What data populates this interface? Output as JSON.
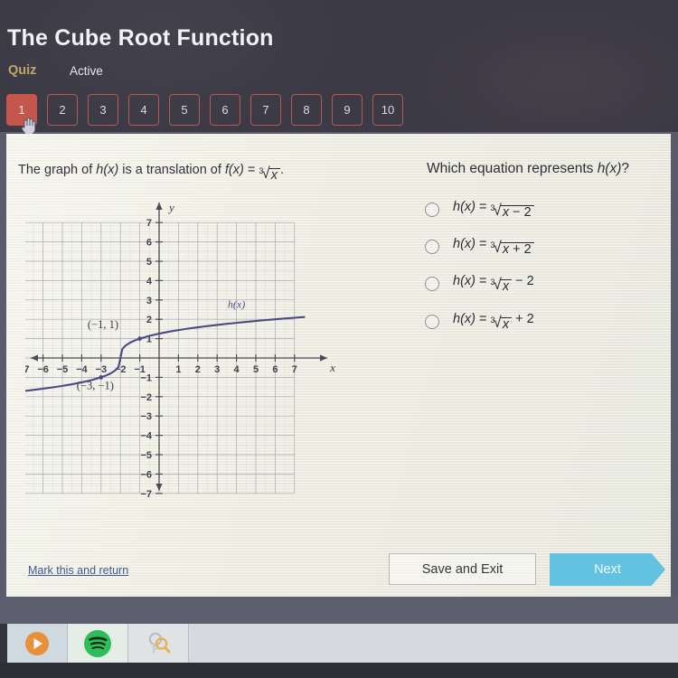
{
  "header": {
    "title": "The Cube Root Function",
    "quiz_label": "Quiz",
    "status_label": "Active",
    "question_numbers": [
      "1",
      "2",
      "3",
      "4",
      "5",
      "6",
      "7",
      "8",
      "9",
      "10"
    ],
    "active_question": "1",
    "background_color": "#3c3a45",
    "active_button_color": "#c4564c",
    "quiz_label_color": "#c0a868"
  },
  "content": {
    "prompt_prefix": "The graph of ",
    "prompt_hx": "h(x)",
    "prompt_middle": " is a translation of ",
    "prompt_fx": "f(x)",
    "prompt_equals": " = ",
    "prompt_radicand": "x",
    "prompt_suffix": ".",
    "question": "Which equation represents h(x)?",
    "options": [
      {
        "id": "opt-a",
        "lhs": "h(x)",
        "eq": "=",
        "index": "3",
        "radicand": "x − 2",
        "outside": "",
        "inside_offset": true,
        "selected": false
      },
      {
        "id": "opt-b",
        "lhs": "h(x)",
        "eq": "=",
        "index": "3",
        "radicand": "x + 2",
        "outside": "",
        "inside_offset": true,
        "selected": false
      },
      {
        "id": "opt-c",
        "lhs": "h(x)",
        "eq": "=",
        "index": "3",
        "radicand": "x",
        "outside": "− 2",
        "inside_offset": false,
        "selected": false
      },
      {
        "id": "opt-d",
        "lhs": "h(x)",
        "eq": "=",
        "index": "3",
        "radicand": "x",
        "outside": "+ 2",
        "inside_offset": false,
        "selected": false
      }
    ]
  },
  "chart_data": {
    "type": "line",
    "title": "",
    "xlabel": "x",
    "ylabel": "y",
    "xlim": [
      -7.6,
      7.6
    ],
    "ylim": [
      -7.6,
      7.6
    ],
    "x_ticks": [
      -7,
      -6,
      -5,
      -4,
      -3,
      -2,
      -1,
      1,
      2,
      3,
      4,
      5,
      6,
      7
    ],
    "y_ticks": [
      7,
      6,
      5,
      4,
      3,
      2,
      1,
      -1,
      -2,
      -3,
      -4,
      -5,
      -6,
      -7
    ],
    "grid": true,
    "grid_minor": true,
    "legend": "none",
    "curve_label": "h(x)",
    "curve_label_x": 4.0,
    "curve_label_y": 2.6,
    "curve_color": "#4a4a86",
    "series": [
      {
        "name": "h(x)",
        "equation": "cbrt(x + 2)",
        "x": [
          -7.5,
          -7.0,
          -6.5,
          -6.0,
          -5.5,
          -5.0,
          -4.5,
          -4.0,
          -3.5,
          -3.0,
          -2.75,
          -2.5,
          -2.25,
          -2.1,
          -2.0,
          -1.9,
          -1.75,
          -1.5,
          -1.25,
          -1.0,
          -0.5,
          0.0,
          0.5,
          1.0,
          1.5,
          2.0,
          2.5,
          3.0,
          3.5,
          4.0,
          4.5,
          5.0,
          5.5,
          6.0,
          6.5,
          7.0,
          7.5
        ],
        "y": [
          -1.754,
          -1.71,
          -1.651,
          -1.587,
          -1.518,
          -1.442,
          -1.357,
          -1.26,
          -1.145,
          -1.0,
          -0.909,
          -0.794,
          -0.63,
          -0.464,
          0.0,
          0.464,
          0.63,
          0.794,
          0.909,
          1.0,
          1.145,
          1.26,
          1.357,
          1.442,
          1.518,
          1.587,
          1.651,
          1.71,
          1.765,
          1.817,
          1.866,
          1.913,
          1.957,
          2.0,
          2.041,
          2.08,
          2.118
        ]
      }
    ],
    "annotations": [
      {
        "label": "(−1, 1)",
        "x": -1.0,
        "y": 1.0,
        "label_x": -2.9,
        "label_y": 1.55
      },
      {
        "label": "(−3, −1)",
        "x": -3.0,
        "y": -1.0,
        "label_x": -3.3,
        "label_y": -1.62
      }
    ]
  },
  "footer": {
    "mark_return": "Mark this and return",
    "save_exit": "Save and Exit",
    "next": "Next",
    "next_color": "#62c2e0"
  },
  "taskbar": {
    "items": [
      {
        "name": "media-play-icon",
        "color": "#e8913a"
      },
      {
        "name": "spotify-icon",
        "color": "#2ebd59"
      },
      {
        "name": "key-search-icon",
        "color": "#e0b64a"
      }
    ]
  }
}
